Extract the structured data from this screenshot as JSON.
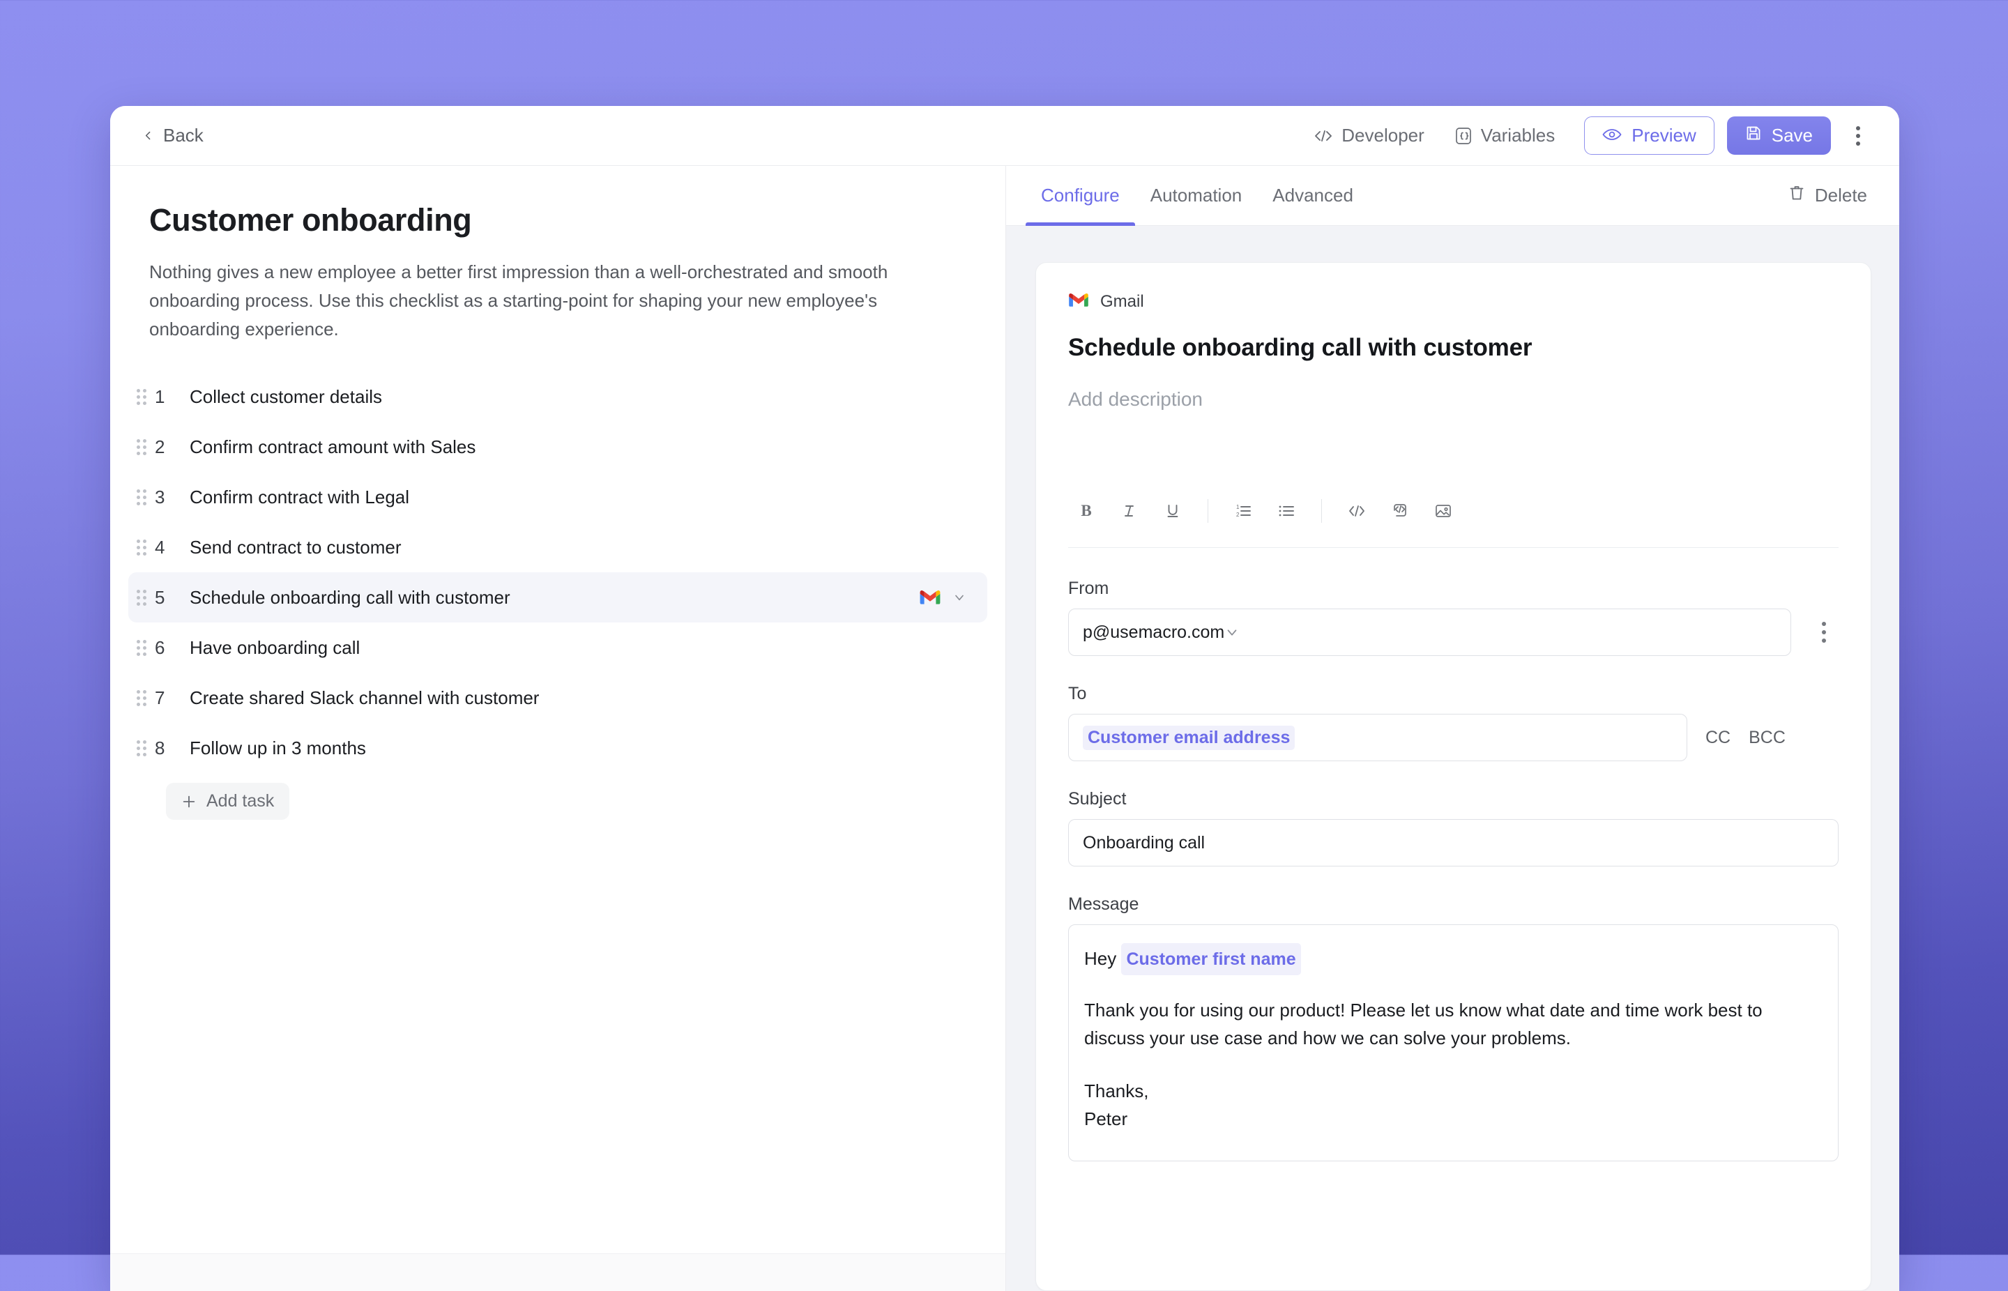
{
  "topbar": {
    "back_label": "Back",
    "developer_label": "Developer",
    "variables_label": "Variables",
    "preview_label": "Preview",
    "save_label": "Save",
    "accent_purple": "#6c6ce8",
    "save_bg": "#7b7ce8"
  },
  "left": {
    "title": "Customer onboarding",
    "description": "Nothing gives a new employee a better first impression than a well-orchestrated and smooth onboarding process. Use this checklist as a starting-point for shaping your new employee's onboarding experience.",
    "add_task_label": "Add task",
    "tasks": [
      {
        "num": "1",
        "label": "Collect customer details",
        "active": false,
        "app": ""
      },
      {
        "num": "2",
        "label": "Confirm contract amount with Sales",
        "active": false,
        "app": ""
      },
      {
        "num": "3",
        "label": "Confirm contract with Legal",
        "active": false,
        "app": ""
      },
      {
        "num": "4",
        "label": "Send contract to customer",
        "active": false,
        "app": ""
      },
      {
        "num": "5",
        "label": "Schedule onboarding call with customer",
        "active": true,
        "app": "gmail"
      },
      {
        "num": "6",
        "label": "Have onboarding call",
        "active": false,
        "app": ""
      },
      {
        "num": "7",
        "label": "Create shared Slack channel with customer",
        "active": false,
        "app": ""
      },
      {
        "num": "8",
        "label": "Follow up in 3 months",
        "active": false,
        "app": ""
      }
    ]
  },
  "right": {
    "tabs": [
      {
        "label": "Configure",
        "active": true
      },
      {
        "label": "Automation",
        "active": false
      },
      {
        "label": "Advanced",
        "active": false
      }
    ],
    "delete_label": "Delete",
    "card": {
      "app_name": "Gmail",
      "title": "Schedule onboarding call with customer",
      "description_placeholder": "Add description",
      "format_tools": [
        "bold-icon",
        "italic-icon",
        "underline-icon",
        "ordered-list-icon",
        "bullet-list-icon",
        "code-inline-icon",
        "code-block-icon",
        "image-icon"
      ],
      "from": {
        "label": "From",
        "value": "p@usemacro.com"
      },
      "to": {
        "label": "To",
        "chip": "Customer email address",
        "cc_label": "CC",
        "bcc_label": "BCC"
      },
      "subject": {
        "label": "Subject",
        "value": "Onboarding call"
      },
      "message": {
        "label": "Message",
        "greeting": "Hey",
        "greeting_chip": "Customer first name",
        "paragraph": "Thank you for using our product! Please let us know what date and time work best to discuss your use case and how we can solve your problems.",
        "signoff": "Thanks,",
        "signer": "Peter"
      }
    }
  }
}
